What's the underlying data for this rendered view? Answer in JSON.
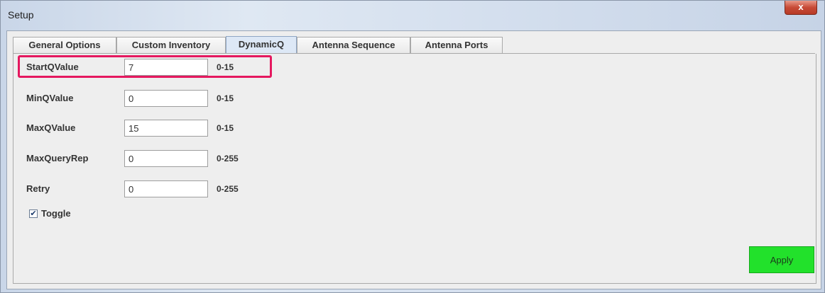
{
  "window": {
    "title": "Setup",
    "close_glyph": "x"
  },
  "tabs": [
    {
      "label": "General Options",
      "active": false
    },
    {
      "label": "Custom Inventory",
      "active": false
    },
    {
      "label": "DynamicQ",
      "active": true
    },
    {
      "label": "Antenna Sequence",
      "active": false
    },
    {
      "label": "Antenna Ports",
      "active": false
    }
  ],
  "fields": [
    {
      "label": "StartQValue",
      "value": "7",
      "range": "0-15",
      "highlighted": true
    },
    {
      "label": "MinQValue",
      "value": "0",
      "range": "0-15"
    },
    {
      "label": "MaxQValue",
      "value": "15",
      "range": "0-15"
    },
    {
      "label": "MaxQueryRep",
      "value": "0",
      "range": "0-255"
    },
    {
      "label": "Retry",
      "value": "0",
      "range": "0-255"
    }
  ],
  "toggle": {
    "label": "Toggle",
    "checked": true,
    "check_glyph": "✔"
  },
  "footer": {
    "apply_label": "Apply"
  },
  "colors": {
    "highlight": "#e5185f",
    "apply": "#22e12b",
    "active_tab": "#dde8f6"
  },
  "icons": {
    "close": "close-icon",
    "checkbox": "check-icon"
  }
}
